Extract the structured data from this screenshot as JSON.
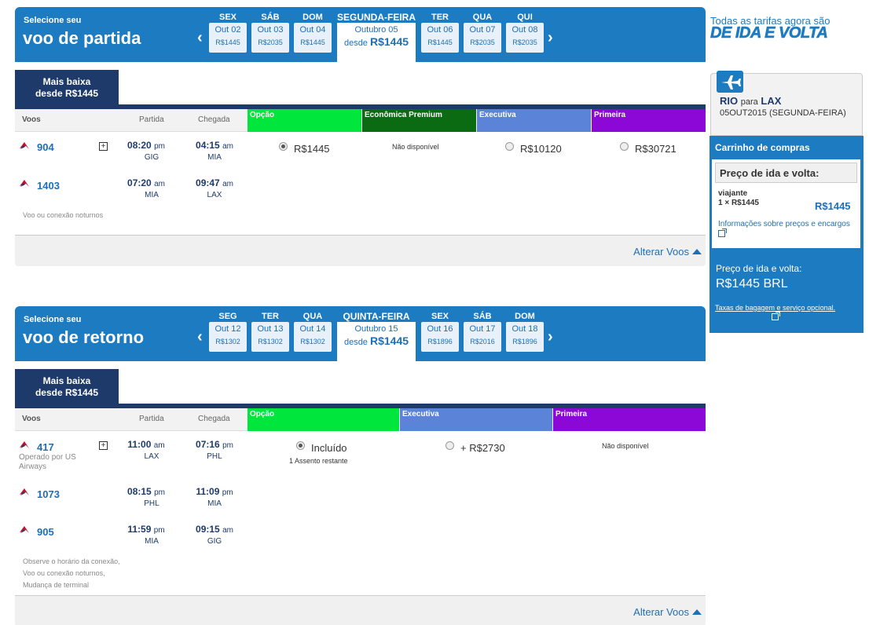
{
  "outbound": {
    "small_title": "Selecione seu",
    "big_title": "voo de partida",
    "prev_arrow": "‹",
    "next_arrow": "›",
    "dates_before": [
      {
        "dow": "SEX",
        "date": "Out 02",
        "price": "R$1445"
      },
      {
        "dow": "SÁB",
        "date": "Out 03",
        "price": "R$2035"
      },
      {
        "dow": "DOM",
        "date": "Out 04",
        "price": "R$1445"
      }
    ],
    "selected": {
      "dow": "SEGUNDA-FEIRA",
      "date": "Outubro 05",
      "desde": "desde",
      "price": "R$1445"
    },
    "dates_after": [
      {
        "dow": "TER",
        "date": "Out 06",
        "price": "R$1445"
      },
      {
        "dow": "QUA",
        "date": "Out 07",
        "price": "R$2035"
      },
      {
        "dow": "QUI",
        "date": "Out 08",
        "price": "R$2035"
      }
    ],
    "lowest_tab": {
      "line1": "Mais baixa",
      "line2": "desde R$1445"
    },
    "table": {
      "col_voos": "Voos",
      "col_partida": "Partida",
      "col_chegada": "Chegada",
      "cabins": [
        {
          "name": "Opção",
          "color": "#00e63c"
        },
        {
          "name": "Econômica Premium",
          "color": "#0a6b12"
        },
        {
          "name": "Executiva",
          "color": "#5b84d8"
        },
        {
          "name": "Primeira",
          "color": "#8b08d6"
        }
      ]
    },
    "flights": [
      {
        "num": "904",
        "dep_time": "08:20",
        "dep_ampm": "pm",
        "dep_apt": "GIG",
        "arr_time": "04:15",
        "arr_ampm": "am",
        "arr_apt": "MIA"
      },
      {
        "num": "1403",
        "dep_time": "07:20",
        "dep_ampm": "am",
        "dep_apt": "MIA",
        "arr_time": "09:47",
        "arr_ampm": "am",
        "arr_apt": "LAX"
      }
    ],
    "fares": {
      "opcao": "R$1445",
      "premium": "Não disponível",
      "executiva": "R$10120",
      "primeira": "R$30721"
    },
    "note": "Voo ou conexão noturnos",
    "alter": "Alterar Voos"
  },
  "inbound": {
    "small_title": "Selecione seu",
    "big_title": "voo de retorno",
    "prev_arrow": "‹",
    "next_arrow": "›",
    "dates_before": [
      {
        "dow": "SEG",
        "date": "Out 12",
        "price": "R$1302"
      },
      {
        "dow": "TER",
        "date": "Out 13",
        "price": "R$1302"
      },
      {
        "dow": "QUA",
        "date": "Out 14",
        "price": "R$1302"
      }
    ],
    "selected": {
      "dow": "QUINTA-FEIRA",
      "date": "Outubro 15",
      "desde": "desde",
      "price": "R$1445"
    },
    "dates_after": [
      {
        "dow": "SEX",
        "date": "Out 16",
        "price": "R$1896"
      },
      {
        "dow": "SÁB",
        "date": "Out 17",
        "price": "R$2016"
      },
      {
        "dow": "DOM",
        "date": "Out 18",
        "price": "R$1896"
      }
    ],
    "lowest_tab": {
      "line1": "Mais baixa",
      "line2": "desde R$1445"
    },
    "table": {
      "col_voos": "Voos",
      "col_partida": "Partida",
      "col_chegada": "Chegada",
      "cabins": [
        {
          "name": "Opção",
          "color": "#00e63c"
        },
        {
          "name": "Executiva",
          "color": "#5b84d8"
        },
        {
          "name": "Primeira",
          "color": "#8b08d6"
        }
      ]
    },
    "flights": [
      {
        "num": "417",
        "operated": "Operado por US Airways",
        "dep_time": "11:00",
        "dep_ampm": "am",
        "dep_apt": "LAX",
        "arr_time": "07:16",
        "arr_ampm": "pm",
        "arr_apt": "PHL"
      },
      {
        "num": "1073",
        "dep_time": "08:15",
        "dep_ampm": "pm",
        "dep_apt": "PHL",
        "arr_time": "11:09",
        "arr_ampm": "pm",
        "arr_apt": "MIA"
      },
      {
        "num": "905",
        "dep_time": "11:59",
        "dep_ampm": "pm",
        "dep_apt": "MIA",
        "arr_time": "09:15",
        "arr_ampm": "am",
        "arr_apt": "GIG"
      }
    ],
    "fares": {
      "opcao": "Incluído",
      "opcao_note": "1 Assento restante",
      "executiva": "+ R$2730",
      "primeira": "Não disponível"
    },
    "notes": [
      "Observe o horário da conexão,",
      "Voo ou conexão noturnos,",
      "Mudança de terminal"
    ],
    "alter": "Alterar Voos"
  },
  "sidebar": {
    "promo_line1": "Todas as tarifas agora são",
    "promo_line2": "DE IDA E VOLTA",
    "route_from": "RIO",
    "route_to_word": "para",
    "route_to": "LAX",
    "route_date": "05OUT2015 (SEGUNDA-FEIRA)",
    "cart_title": "Carrinho de compras",
    "cart_sub": "Preço de ida e volta:",
    "traveler_label": "viajante",
    "traveler_count": "1 × R$1445",
    "traveler_price": "R$1445",
    "price_info": "Informações sobre preços e encargos",
    "total_label": "Preço de ida e volta:",
    "total_value": "R$1445 BRL",
    "bag_link": "Taxas de bagagem e serviço opcional."
  },
  "colors": {
    "brand_blue": "#1d7bc1",
    "navy": "#1e3a6b",
    "aa_red": "#c8102e"
  }
}
